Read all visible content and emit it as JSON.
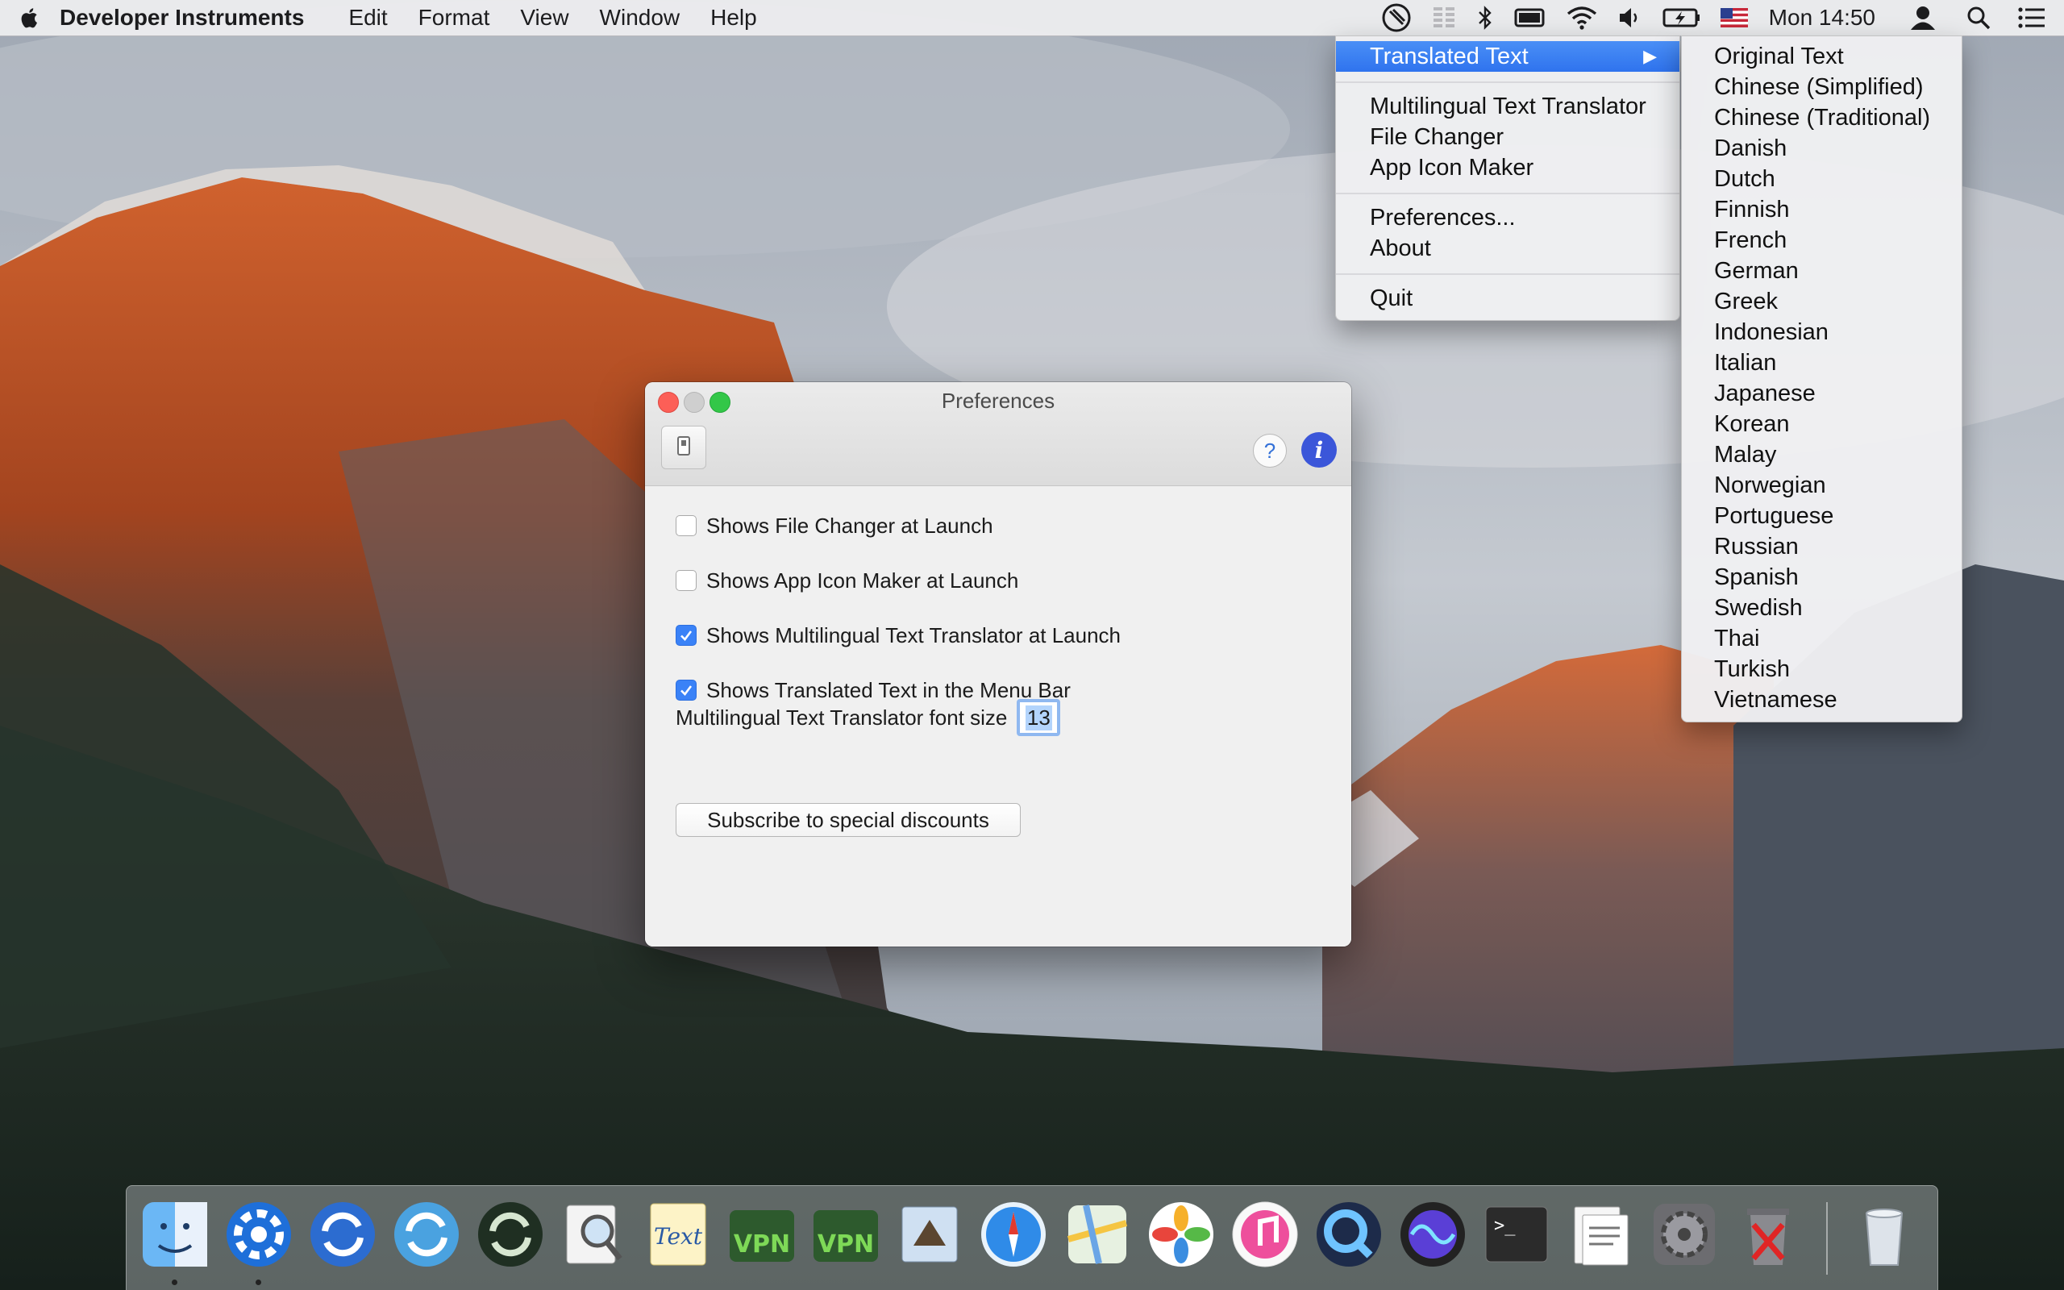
{
  "menubar": {
    "app_name": "Developer Instruments",
    "menus": [
      "Edit",
      "Format",
      "View",
      "Window",
      "Help"
    ],
    "clock": "Mon 14:50",
    "status_icons": [
      "app-status-icon",
      "text-columns-icon",
      "bluetooth-icon",
      "battery-monitor-icon",
      "wifi-icon",
      "volume-icon",
      "battery-charging-icon",
      "us-flag-icon",
      "user-icon",
      "spotlight-search-icon",
      "notification-center-icon"
    ]
  },
  "main_menu": {
    "translated_text": "Translated Text",
    "arrow": "▶",
    "translator": "Multilingual Text Translator",
    "file_changer": "File Changer",
    "icon_maker": "App Icon Maker",
    "preferences": "Preferences...",
    "about": "About",
    "quit": "Quit",
    "highlight_color": "#3b82f6"
  },
  "languages": [
    "Original Text",
    "Chinese (Simplified)",
    "Chinese (Traditional)",
    "Danish",
    "Dutch",
    "Finnish",
    "French",
    "German",
    "Greek",
    "Indonesian",
    "Italian",
    "Japanese",
    "Korean",
    "Malay",
    "Norwegian",
    "Portuguese",
    "Russian",
    "Spanish",
    "Swedish",
    "Thai",
    "Turkish",
    "Vietnamese"
  ],
  "preferences": {
    "title": "Preferences",
    "help_label": "?",
    "info_label": "i",
    "options": [
      {
        "label": "Shows File Changer at Launch",
        "checked": false
      },
      {
        "label": "Shows App Icon Maker at Launch",
        "checked": false
      },
      {
        "label": "Shows Multilingual Text Translator at Launch",
        "checked": true
      },
      {
        "label": "Shows Translated Text in the Menu Bar",
        "checked": true
      }
    ],
    "font_size_label": "Multilingual Text Translator font size",
    "font_size_value": "13",
    "subscribe_label": "Subscribe to special discounts"
  },
  "dock": {
    "apps": [
      "Finder",
      "Developer Instruments",
      "Sync",
      "Sync Utility",
      "Data Sync",
      "Preview",
      "Text",
      "VPN Agent",
      "VPN",
      "Mail",
      "Safari",
      "Maps",
      "Photos",
      "iTunes",
      "QuickTime Player",
      "Siri",
      "Terminal",
      "Documents",
      "System Preferences",
      "Uninstaller",
      "Trash"
    ],
    "running": [
      "Finder",
      "Developer Instruments"
    ]
  },
  "colors": {
    "accent": "#3a82f7",
    "close": "#fc5f57",
    "zoom": "#33c748"
  }
}
